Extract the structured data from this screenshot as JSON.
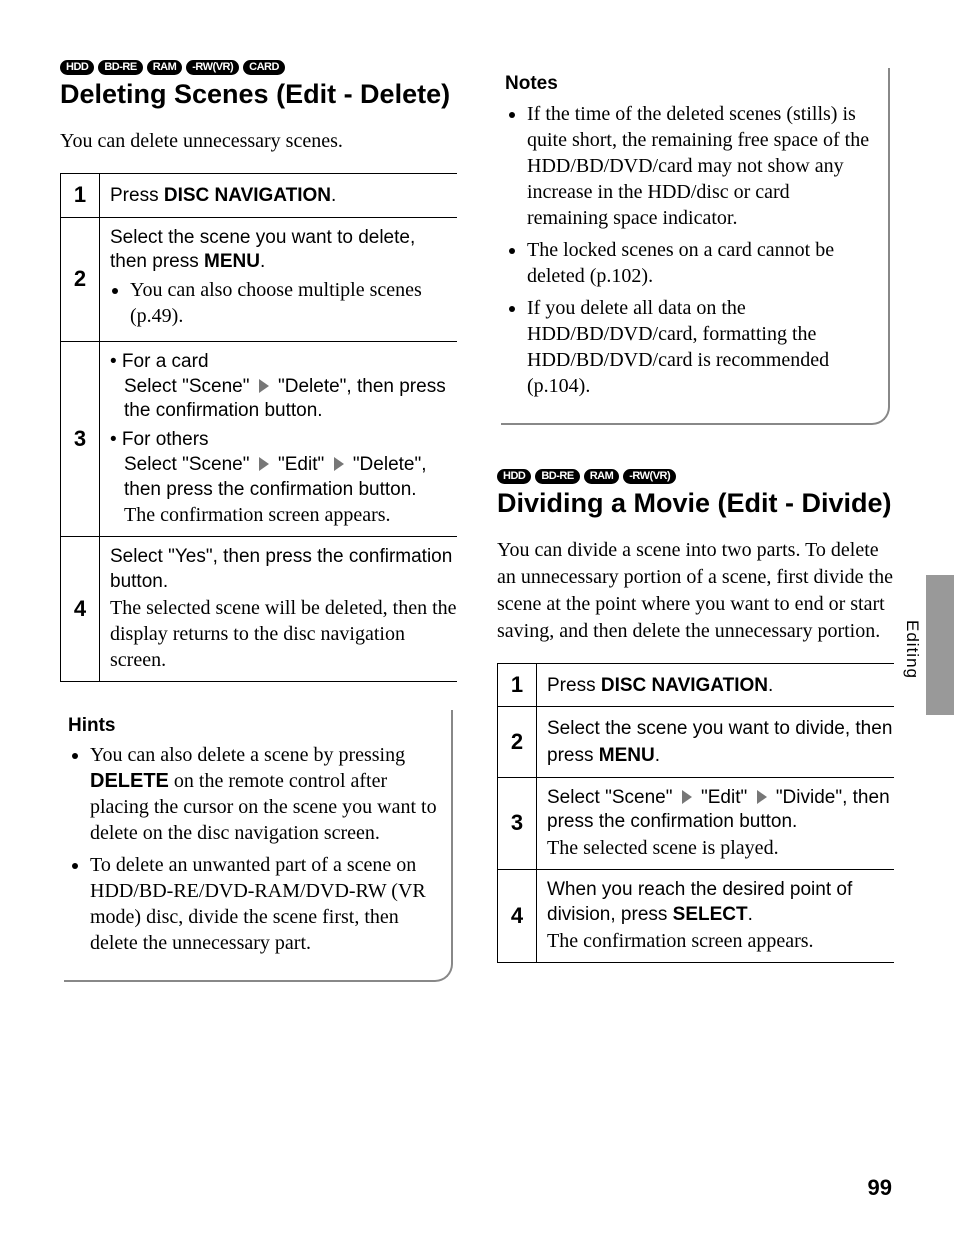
{
  "side_label": "Editing",
  "page_number": "99",
  "section1": {
    "tags": [
      "HDD",
      "BD-RE",
      "RAM",
      "-RW(VR)",
      "CARD"
    ],
    "title": "Deleting Scenes (Edit - Delete)",
    "intro": "You can delete unnecessary scenes.",
    "step1": {
      "num": "1",
      "lead_pre": "Press ",
      "lead_bold": "DISC NAVIGATION",
      "lead_post": "."
    },
    "step2": {
      "num": "2",
      "lead_pre": "Select the scene you want to delete, then press ",
      "lead_bold": "MENU",
      "lead_post": ".",
      "note": "You can also choose multiple scenes (p.49)."
    },
    "step3": {
      "num": "3",
      "card_label": "• For a card",
      "card_line1a": "Select \"Scene\"",
      "card_line1b": "\"Delete\", then press the confirmation button.",
      "others_label": "• For others",
      "others_line1a": "Select \"Scene\"",
      "others_line1b": "\"Edit\"",
      "others_line1c": "\"Delete\", then press the confirmation button.",
      "note": "The confirmation screen appears."
    },
    "step4": {
      "num": "4",
      "lead": "Select \"Yes\", then press the confirmation button.",
      "note": "The selected scene will be deleted, then the display returns to the disc navigation screen."
    },
    "hints_title": "Hints",
    "hint1_pre": "You can also delete a scene by pressing ",
    "hint1_bold": "DELETE",
    "hint1_post": " on the remote control after placing the cursor on the scene you want to delete on the disc navigation screen.",
    "hint2": "To delete an unwanted part of a scene on HDD/BD-RE/DVD-RAM/DVD-RW (VR mode) disc, divide the scene first, then delete the unnecessary part."
  },
  "section2": {
    "notes_title": "Notes",
    "note1": "If the time of the deleted scenes (stills) is quite short, the remaining free space of the HDD/BD/DVD/card may not show any increase in the HDD/disc or card remaining space indicator.",
    "note2": "The locked scenes on a card cannot be deleted (p.102).",
    "note3": "If you delete all data on the HDD/BD/DVD/card, formatting the HDD/BD/DVD/card is recommended (p.104).",
    "tags": [
      "HDD",
      "BD-RE",
      "RAM",
      "-RW(VR)"
    ],
    "title": "Dividing a Movie (Edit - Divide)",
    "intro": "You can divide a scene into two parts. To delete an unnecessary portion of a scene, first divide the scene at the point where you want to end or start saving, and then delete the unnecessary portion.",
    "step1": {
      "num": "1",
      "lead_pre": "Press ",
      "lead_bold": "DISC NAVIGATION",
      "lead_post": "."
    },
    "step2": {
      "num": "2",
      "lead_pre": "Select the scene you want to divide, then press ",
      "lead_bold": "MENU",
      "lead_post": "."
    },
    "step3": {
      "num": "3",
      "line1a": "Select \"Scene\"",
      "line1b": "\"Edit\"",
      "line1c": "\"Divide\", then press the confirmation button.",
      "note": "The selected scene is played."
    },
    "step4": {
      "num": "4",
      "lead_pre": "When you reach the desired point of division, press ",
      "lead_bold": "SELECT",
      "lead_post": ".",
      "note": "The confirmation screen appears."
    }
  }
}
